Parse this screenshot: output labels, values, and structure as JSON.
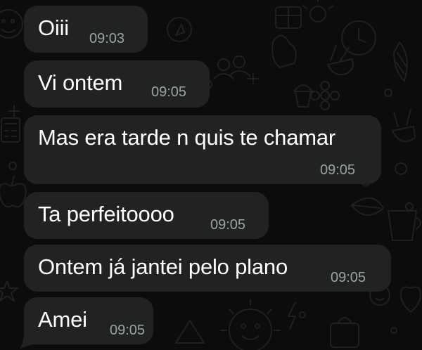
{
  "messages": [
    {
      "text": "Oiii",
      "time": "09:03"
    },
    {
      "text": "Vi ontem",
      "time": "09:05"
    },
    {
      "text": "Mas era tarde n quis te chamar",
      "time": "09:05"
    },
    {
      "text": "Ta perfeitoooo",
      "time": "09:05"
    },
    {
      "text": "Ontem já jantei pelo plano",
      "time": "09:05"
    },
    {
      "text": "Amei",
      "time": "09:05"
    }
  ],
  "colors": {
    "background": "#0b0c0b",
    "bubble": "#202321",
    "text": "#ffffff",
    "timestamp": "#9ea3a0"
  }
}
